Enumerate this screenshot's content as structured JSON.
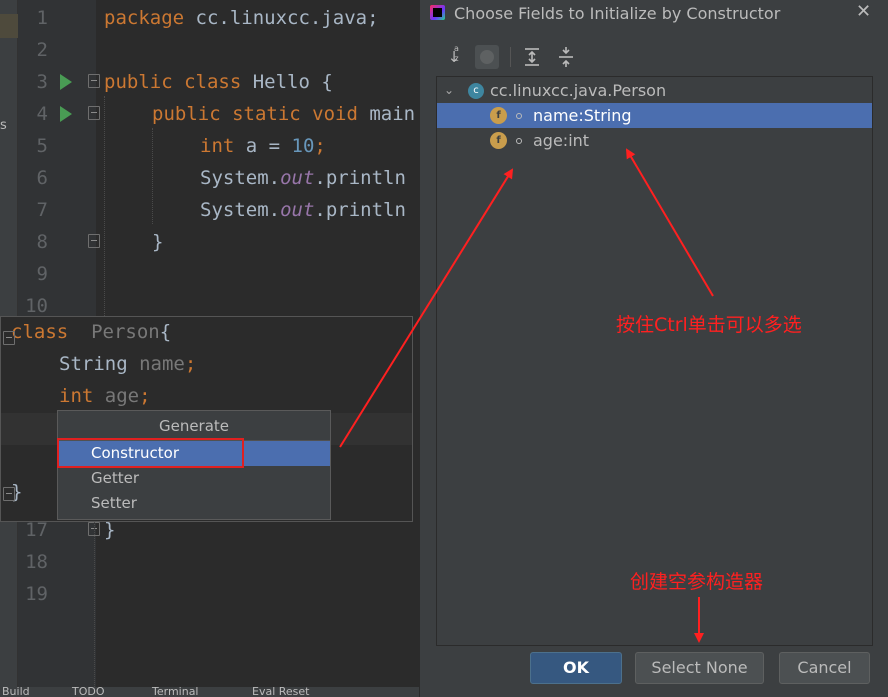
{
  "editor": {
    "line_numbers": [
      "1",
      "2",
      "3",
      "4",
      "5",
      "6",
      "7",
      "8",
      "9",
      "10",
      "17",
      "18",
      "19"
    ],
    "left_strip_fragment": "s",
    "lines": {
      "l1": {
        "kw": "package",
        "rest": " cc.linuxcc.java;"
      },
      "l3": {
        "kw": "public class",
        "rest": " Hello {"
      },
      "l4": {
        "kw": "public static void",
        "rest": " main"
      },
      "l5": {
        "kw": "int",
        "rest": " a = ",
        "num": "10",
        "end": ";"
      },
      "l6": {
        "pre": "System.",
        "field": "out",
        "rest": ".println"
      },
      "l7": {
        "pre": "System.",
        "field": "out",
        "rest": ".println"
      },
      "l8": {
        "rest": "}"
      },
      "l17": {
        "rest": "}"
      }
    }
  },
  "popup": {
    "line1": {
      "kw": "class",
      "name": "  Person",
      "brace": "{"
    },
    "line2": {
      "type": "String",
      "name": " name",
      "semi": ";"
    },
    "line3": {
      "type": "int",
      "name": " age",
      "semi": ";"
    },
    "close": "}"
  },
  "generate_menu": {
    "title": "Generate",
    "items": [
      "Constructor",
      "Getter",
      "Setter"
    ],
    "selected": "Constructor"
  },
  "status_strip": [
    "Build",
    "TODO",
    "Terminal",
    "Eval Reset"
  ],
  "dialog": {
    "title": "Choose Fields to Initialize by Constructor",
    "tree": {
      "class_name": "cc.linuxcc.java.Person",
      "class_icon_letter": "c",
      "field_icon_letter": "f",
      "fields": [
        "name:String",
        "age:int"
      ],
      "selected_field": "name:String"
    },
    "buttons": {
      "ok": "OK",
      "select_none": "Select None",
      "cancel": "Cancel"
    }
  },
  "annotations": {
    "multi_select": "按住Ctrl单击可以多选",
    "empty_constructor": "创建空参构造器"
  },
  "colors": {
    "editor_bg": "#2b2b2b",
    "dialog_bg": "#3c3f41",
    "selection": "#4b6eaf",
    "keyword": "#cc7832",
    "annotation_red": "#ff2020"
  }
}
